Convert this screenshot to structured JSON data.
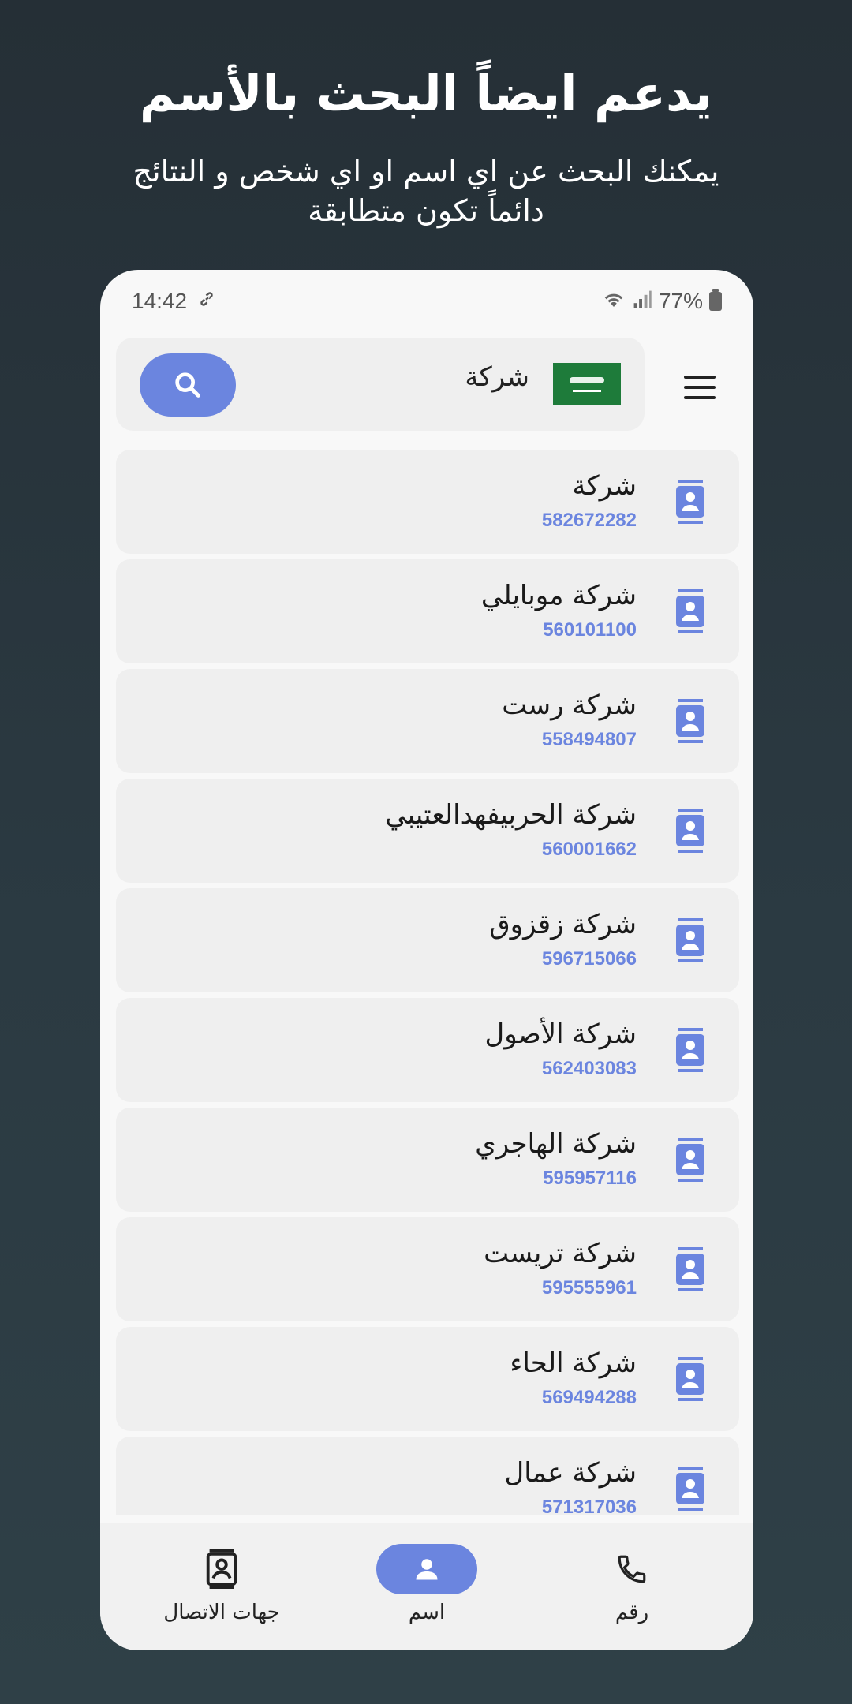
{
  "promo": {
    "title": "يدعم ايضاً البحث بالأسم",
    "subtitle": "يمكنك البحث عن اي اسم او اي شخص و النتائج دائماً تكون متطابقة"
  },
  "status_bar": {
    "time": "14:42",
    "battery": "77%"
  },
  "search": {
    "query": "شركة",
    "button_icon": "search-icon",
    "flag_icon": "saudi-flag-icon",
    "menu_icon": "hamburger-menu-icon"
  },
  "results": [
    {
      "name": "شركة",
      "number": "582672282"
    },
    {
      "name": "شركة موبايلي",
      "number": "560101100"
    },
    {
      "name": "شركة رست",
      "number": "558494807"
    },
    {
      "name": "شركة الحربيفهدالعتيبي",
      "number": "560001662"
    },
    {
      "name": "شركة زقزوق",
      "number": "596715066"
    },
    {
      "name": "شركة الأصول",
      "number": "562403083"
    },
    {
      "name": "شركة الهاجري",
      "number": "595957116"
    },
    {
      "name": "شركة تريست",
      "number": "595555961"
    },
    {
      "name": "شركة الحاء",
      "number": "569494288"
    },
    {
      "name": "شركة عمال",
      "number": "571317036"
    }
  ],
  "bottom_nav": {
    "contacts_label": "جهات الاتصال",
    "name_label": "اسم",
    "number_label": "رقم"
  },
  "colors": {
    "accent": "#6b85df",
    "background": "#252f36",
    "card": "#efefef"
  }
}
